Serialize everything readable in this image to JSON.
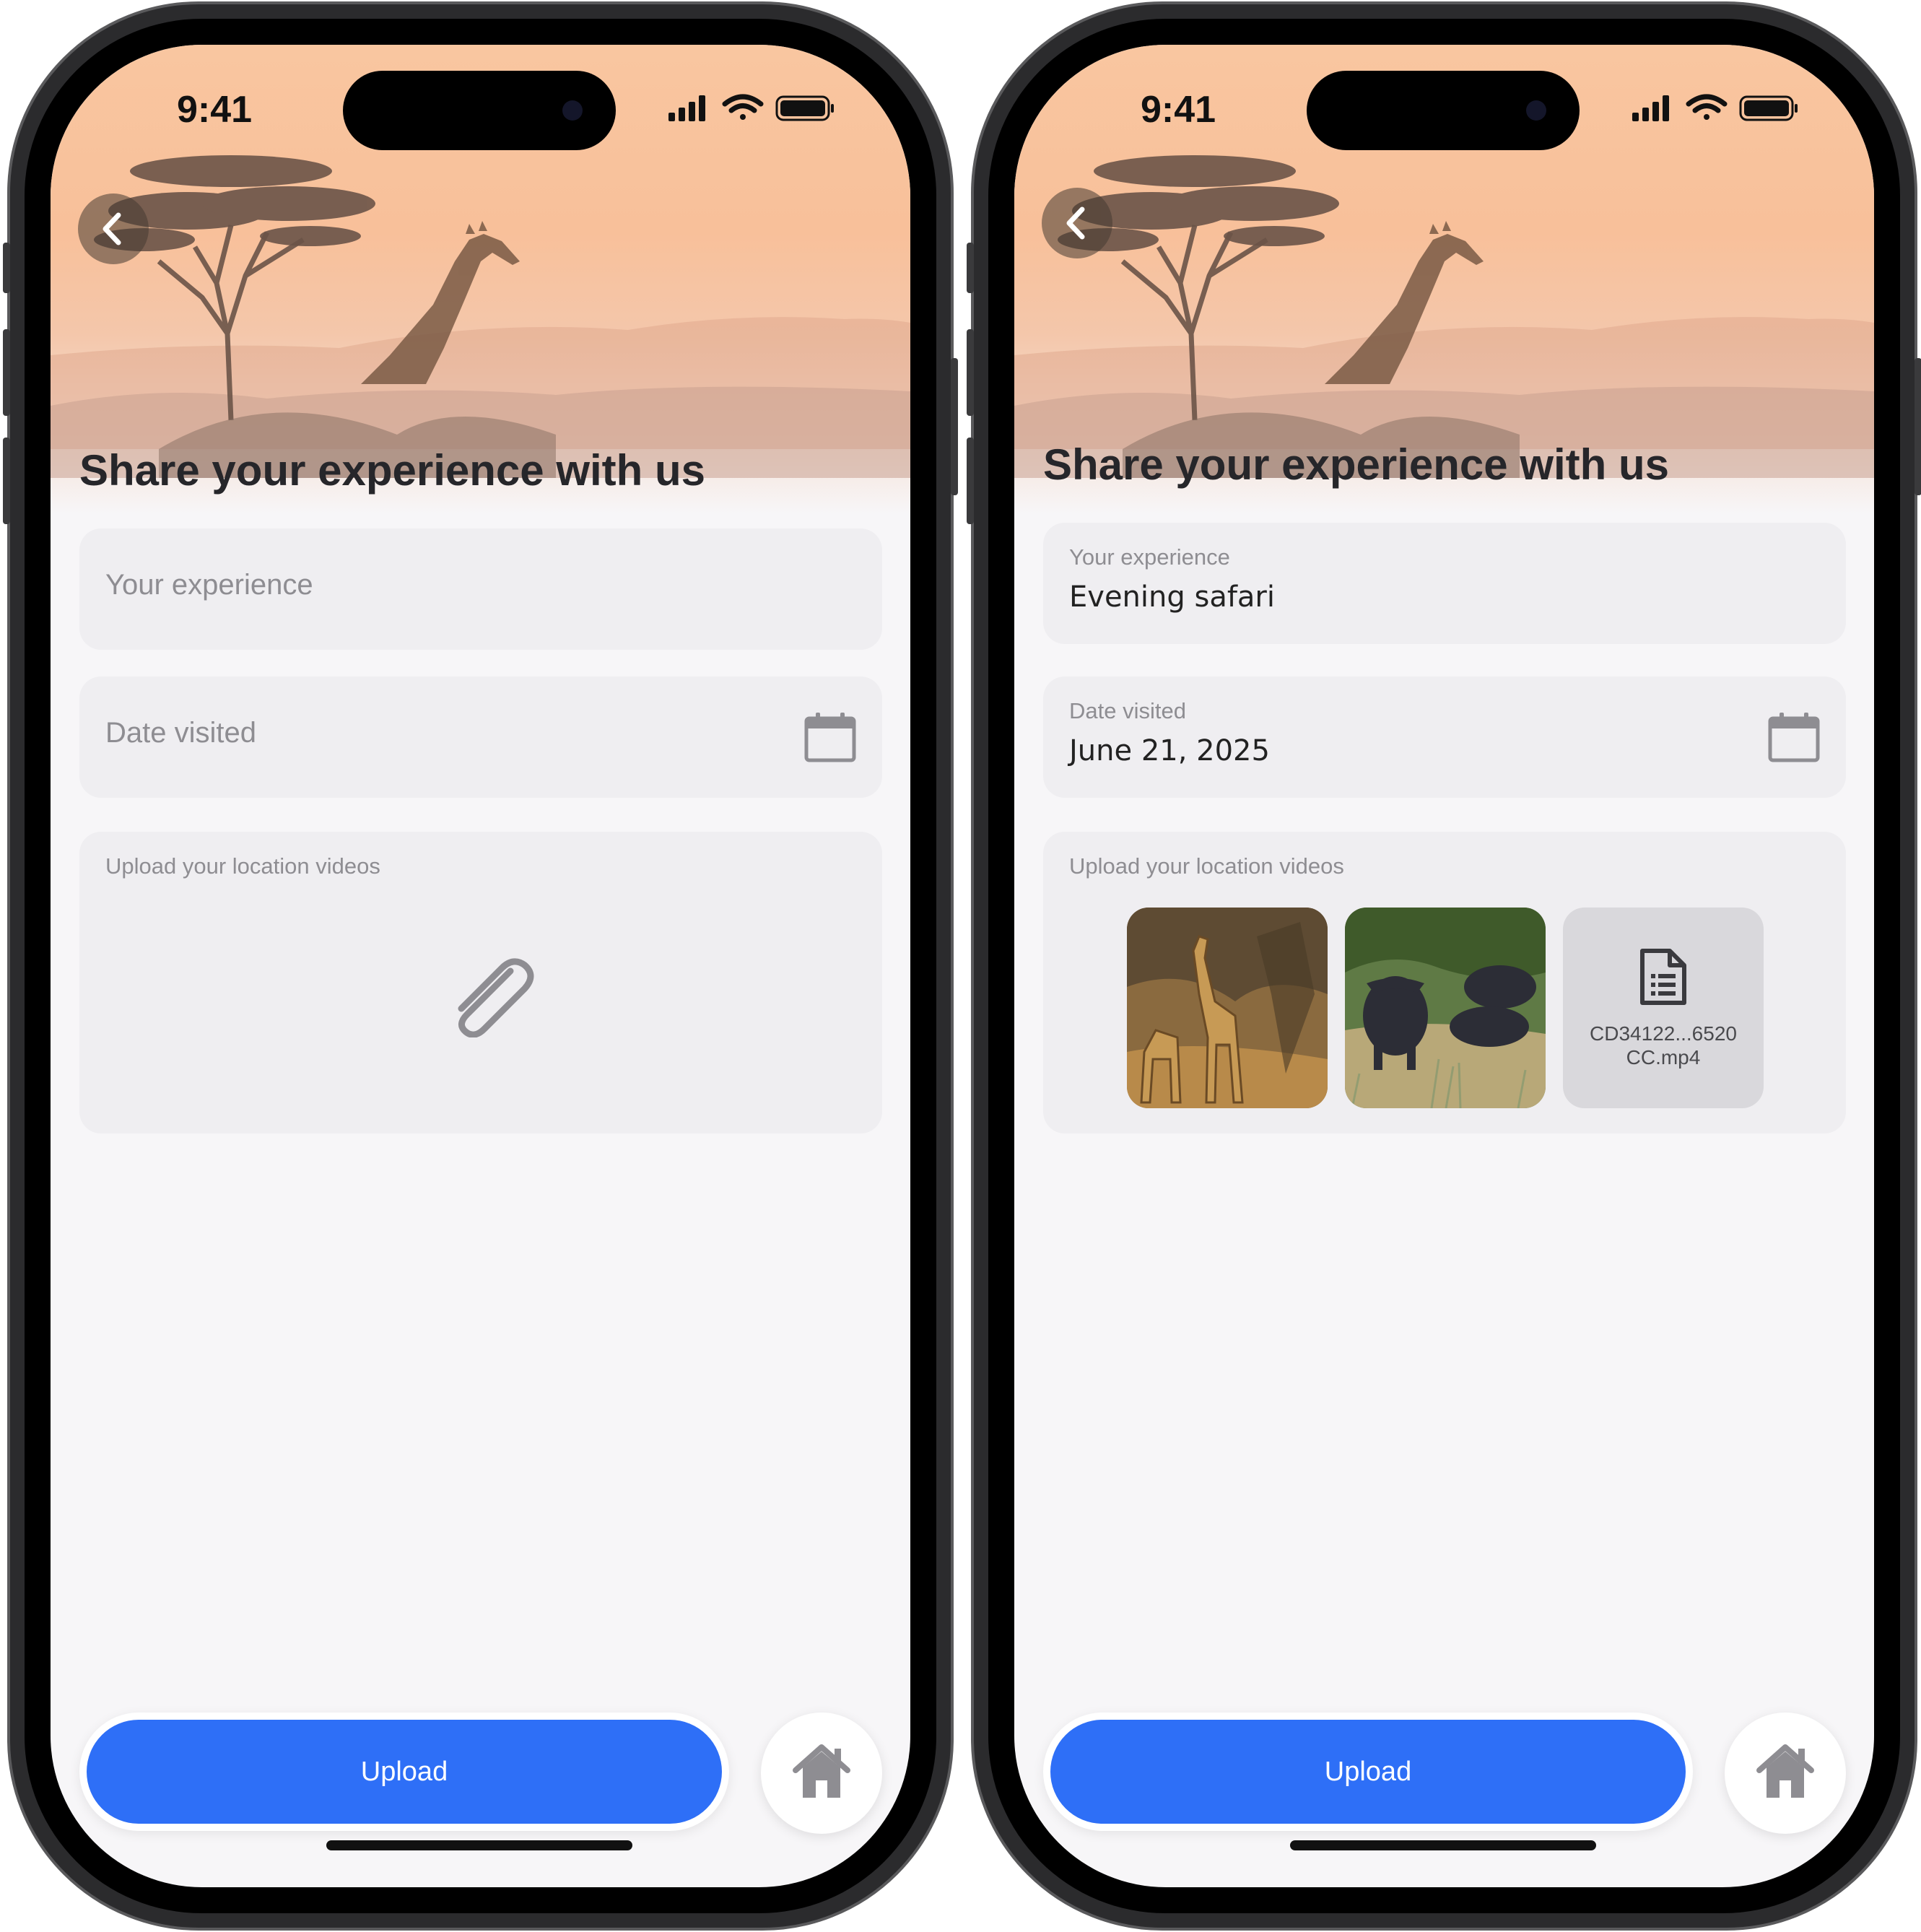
{
  "screens": [
    {
      "status": {
        "time": "9:41"
      },
      "title": "Share your experience with us",
      "experience": {
        "placeholder": "Your experience",
        "label": "",
        "value": ""
      },
      "date": {
        "placeholder": "Date visited",
        "label": "",
        "value": ""
      },
      "videos": {
        "label": "Upload your location videos",
        "file_name_line1": "",
        "file_name_line2": ""
      },
      "actions": {
        "upload_label": "Upload"
      }
    },
    {
      "status": {
        "time": "9:41"
      },
      "title": "Share your experience with us",
      "experience": {
        "placeholder": "",
        "label": "Your experience",
        "value": "Evening safari"
      },
      "date": {
        "placeholder": "",
        "label": "Date visited",
        "value": "June 21, 2025"
      },
      "videos": {
        "label": "Upload your location videos",
        "file_name_line1": "CD34122...6520",
        "file_name_line2": "CC.mp4"
      },
      "actions": {
        "upload_label": "Upload"
      }
    }
  ],
  "colors": {
    "accent": "#2e6ff7",
    "hero_sky": "#f9c6a0",
    "field_bg": "#efeef1",
    "screen_bg": "#f7f6f8"
  },
  "icons": [
    "back-chevron-icon",
    "calendar-icon",
    "paperclip-icon",
    "document-icon",
    "home-icon",
    "cellular-signal-icon",
    "wifi-icon",
    "battery-icon"
  ]
}
